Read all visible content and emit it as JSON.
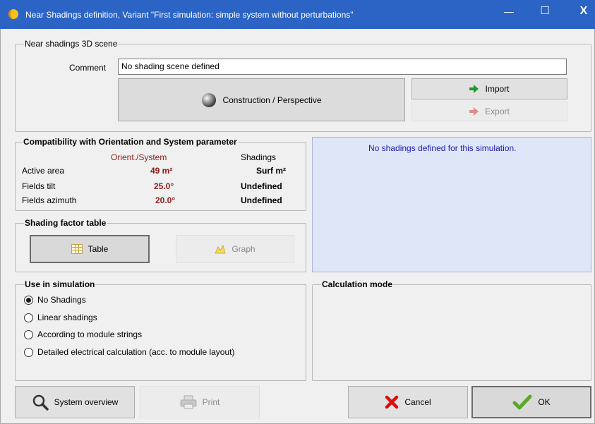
{
  "window": {
    "title": "Near Shadings definition, Variant \"First simulation: simple system without perturbations\"",
    "minimize_glyph": "—",
    "maximize_glyph": "☐",
    "close_glyph": "X"
  },
  "scene": {
    "legend": "Near shadings 3D scene",
    "comment_label": "Comment",
    "comment_value": "No shading scene defined",
    "construction_label": "Construction / Perspective",
    "import_label": "Import",
    "export_label": "Export"
  },
  "compat": {
    "legend": "Compatibility with Orientation and System parameter",
    "col_orient": "Orient./System",
    "col_shadings": "Shadings",
    "rows": [
      {
        "label": "Active area",
        "orient": "49 m²",
        "shadings": "Surf m²"
      },
      {
        "label": "Fields tilt",
        "orient": "25.0°",
        "shadings": "Undefined"
      },
      {
        "label": "Fields azimuth",
        "orient": "20.0°",
        "shadings": "Undefined"
      }
    ]
  },
  "info": {
    "message": "No shadings defined for this simulation."
  },
  "sft": {
    "legend": "Shading factor table",
    "table_label": "Table",
    "graph_label": "Graph"
  },
  "use": {
    "legend": "Use in simulation",
    "options": [
      {
        "label": "No Shadings",
        "selected": true
      },
      {
        "label": "Linear shadings",
        "selected": false
      },
      {
        "label": "According to module strings",
        "selected": false
      },
      {
        "label": "Detailed electrical calculation (acc. to module layout)",
        "selected": false
      }
    ]
  },
  "calc": {
    "legend": "Calculation mode"
  },
  "footer": {
    "overview_label": "System overview",
    "print_label": "Print",
    "cancel_label": "Cancel",
    "ok_label": "OK"
  },
  "colors": {
    "titlebar": "#2b64c4",
    "info_bg": "#dfe6f8",
    "info_text": "#1a1ab0",
    "value_red": "#8b1a1a"
  }
}
